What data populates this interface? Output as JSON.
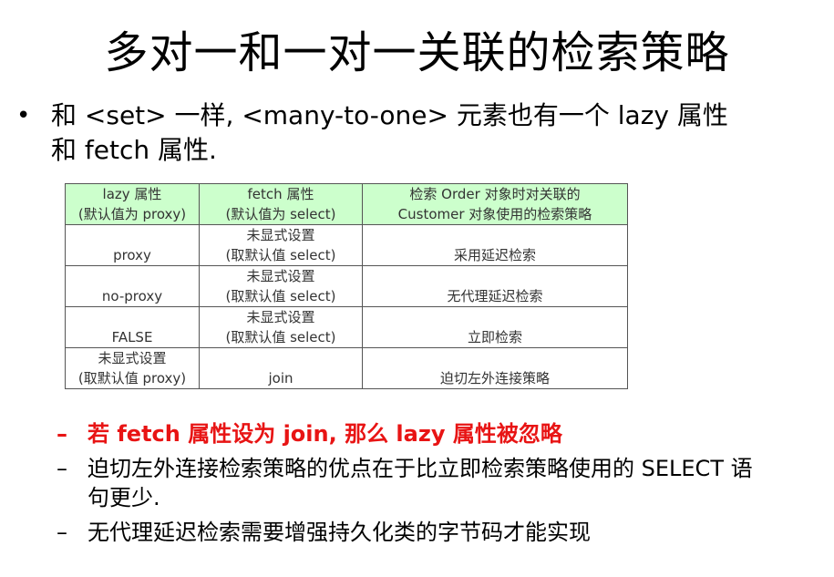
{
  "title": "多对一和一对一关联的检索策略",
  "bullet": {
    "marker": "•",
    "lines": [
      "和 <set> 一样, <many-to-one> 元素也有一个 lazy 属性",
      "和 fetch 属性."
    ]
  },
  "table": {
    "header": [
      [
        "lazy 属性",
        "(默认值为 proxy)"
      ],
      [
        "fetch 属性",
        "(默认值为 select)"
      ],
      [
        "检索 Order 对象时对关联的",
        "Customer 对象使用的检索策略"
      ]
    ],
    "rows": [
      [
        [
          "proxy"
        ],
        [
          "未显式设置",
          "(取默认值 select)"
        ],
        [
          "采用延迟检索"
        ]
      ],
      [
        [
          "no-proxy"
        ],
        [
          "未显式设置",
          "(取默认值 select)"
        ],
        [
          "无代理延迟检索"
        ]
      ],
      [
        [
          "FALSE"
        ],
        [
          "未显式设置",
          "(取默认值 select)"
        ],
        [
          "立即检索"
        ]
      ],
      [
        [
          "未显式设置",
          "(取默认值 proxy)"
        ],
        [
          "join"
        ],
        [
          "迫切左外连接策略"
        ]
      ]
    ],
    "header_color": "#ccffcc"
  },
  "sub_items": [
    {
      "dash": "–",
      "lines": [
        "若 fetch 属性设为 join, 那么 lazy 属性被忽略"
      ],
      "highlight": true,
      "color": "#e81414"
    },
    {
      "dash": "–",
      "lines": [
        "迫切左外连接检索策略的优点在于比立即检索策略使用的 SELECT 语",
        "句更少."
      ],
      "highlight": false
    },
    {
      "dash": "–",
      "lines": [
        "无代理延迟检索需要增强持久化类的字节码才能实现"
      ],
      "highlight": false
    }
  ]
}
